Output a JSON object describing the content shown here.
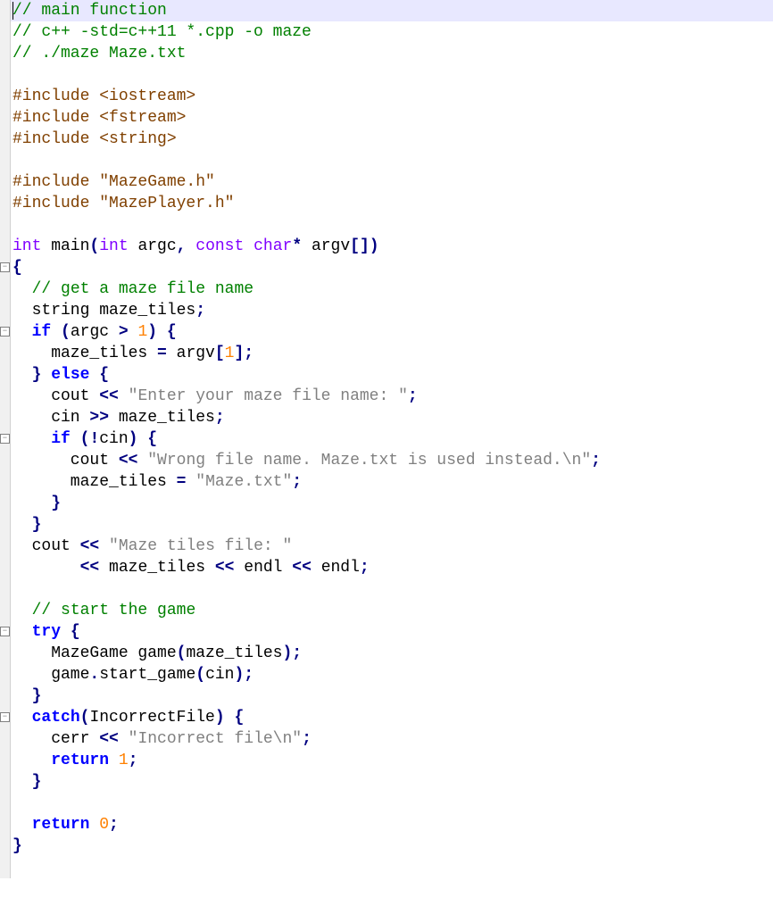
{
  "fold_markers": [
    {
      "line": 12,
      "symbol": "⊟"
    },
    {
      "line": 15,
      "symbol": "⊟"
    },
    {
      "line": 20,
      "symbol": "⊟"
    },
    {
      "line": 29,
      "symbol": "⊟"
    },
    {
      "line": 33,
      "symbol": "⊟"
    }
  ],
  "code_lines": [
    {
      "i": 0,
      "hl": true,
      "tokens": [
        {
          "t": "comment",
          "v": "// main function"
        }
      ],
      "cursor": true
    },
    {
      "i": 1,
      "tokens": [
        {
          "t": "comment",
          "v": "// c++ -std=c++11 *.cpp -o maze"
        }
      ]
    },
    {
      "i": 2,
      "tokens": [
        {
          "t": "comment",
          "v": "// ./maze Maze.txt"
        }
      ]
    },
    {
      "i": 3,
      "tokens": []
    },
    {
      "i": 4,
      "tokens": [
        {
          "t": "preproc",
          "v": "#include <iostream>"
        }
      ]
    },
    {
      "i": 5,
      "tokens": [
        {
          "t": "preproc",
          "v": "#include <fstream>"
        }
      ]
    },
    {
      "i": 6,
      "tokens": [
        {
          "t": "preproc",
          "v": "#include <string>"
        }
      ]
    },
    {
      "i": 7,
      "tokens": []
    },
    {
      "i": 8,
      "tokens": [
        {
          "t": "preproc",
          "v": "#include \"MazeGame.h\""
        }
      ]
    },
    {
      "i": 9,
      "tokens": [
        {
          "t": "preproc",
          "v": "#include \"MazePlayer.h\""
        }
      ]
    },
    {
      "i": 10,
      "tokens": []
    },
    {
      "i": 11,
      "tokens": [
        {
          "t": "type",
          "v": "int"
        },
        {
          "t": "ident",
          "v": " main"
        },
        {
          "t": "op",
          "v": "("
        },
        {
          "t": "type",
          "v": "int"
        },
        {
          "t": "ident",
          "v": " argc"
        },
        {
          "t": "op",
          "v": ","
        },
        {
          "t": "ident",
          "v": " "
        },
        {
          "t": "type",
          "v": "const"
        },
        {
          "t": "ident",
          "v": " "
        },
        {
          "t": "type",
          "v": "char"
        },
        {
          "t": "op",
          "v": "*"
        },
        {
          "t": "ident",
          "v": " argv"
        },
        {
          "t": "op",
          "v": "[])"
        }
      ]
    },
    {
      "i": 12,
      "tokens": [
        {
          "t": "op",
          "v": "{"
        }
      ]
    },
    {
      "i": 13,
      "tokens": [
        {
          "t": "ident",
          "v": "  "
        },
        {
          "t": "comment",
          "v": "// get a maze file name"
        }
      ]
    },
    {
      "i": 14,
      "tokens": [
        {
          "t": "ident",
          "v": "  string maze_tiles"
        },
        {
          "t": "op",
          "v": ";"
        }
      ]
    },
    {
      "i": 15,
      "tokens": [
        {
          "t": "ident",
          "v": "  "
        },
        {
          "t": "keyword",
          "v": "if"
        },
        {
          "t": "ident",
          "v": " "
        },
        {
          "t": "op",
          "v": "("
        },
        {
          "t": "ident",
          "v": "argc "
        },
        {
          "t": "op",
          "v": ">"
        },
        {
          "t": "ident",
          "v": " "
        },
        {
          "t": "number",
          "v": "1"
        },
        {
          "t": "op",
          "v": ")"
        },
        {
          "t": "ident",
          "v": " "
        },
        {
          "t": "op",
          "v": "{"
        }
      ]
    },
    {
      "i": 16,
      "tokens": [
        {
          "t": "ident",
          "v": "    maze_tiles "
        },
        {
          "t": "op",
          "v": "="
        },
        {
          "t": "ident",
          "v": " argv"
        },
        {
          "t": "op",
          "v": "["
        },
        {
          "t": "number",
          "v": "1"
        },
        {
          "t": "op",
          "v": "];"
        }
      ]
    },
    {
      "i": 17,
      "tokens": [
        {
          "t": "ident",
          "v": "  "
        },
        {
          "t": "op",
          "v": "}"
        },
        {
          "t": "ident",
          "v": " "
        },
        {
          "t": "keyword",
          "v": "else"
        },
        {
          "t": "ident",
          "v": " "
        },
        {
          "t": "op",
          "v": "{"
        }
      ]
    },
    {
      "i": 18,
      "tokens": [
        {
          "t": "ident",
          "v": "    cout "
        },
        {
          "t": "op",
          "v": "<<"
        },
        {
          "t": "ident",
          "v": " "
        },
        {
          "t": "string",
          "v": "\"Enter your maze file name: \""
        },
        {
          "t": "op",
          "v": ";"
        }
      ]
    },
    {
      "i": 19,
      "tokens": [
        {
          "t": "ident",
          "v": "    cin "
        },
        {
          "t": "op",
          "v": ">>"
        },
        {
          "t": "ident",
          "v": " maze_tiles"
        },
        {
          "t": "op",
          "v": ";"
        }
      ]
    },
    {
      "i": 20,
      "tokens": [
        {
          "t": "ident",
          "v": "    "
        },
        {
          "t": "keyword",
          "v": "if"
        },
        {
          "t": "ident",
          "v": " "
        },
        {
          "t": "op",
          "v": "(!"
        },
        {
          "t": "ident",
          "v": "cin"
        },
        {
          "t": "op",
          "v": ")"
        },
        {
          "t": "ident",
          "v": " "
        },
        {
          "t": "op",
          "v": "{"
        }
      ]
    },
    {
      "i": 21,
      "tokens": [
        {
          "t": "ident",
          "v": "      cout "
        },
        {
          "t": "op",
          "v": "<<"
        },
        {
          "t": "ident",
          "v": " "
        },
        {
          "t": "string",
          "v": "\"Wrong file name. Maze.txt is used instead.\\n\""
        },
        {
          "t": "op",
          "v": ";"
        }
      ]
    },
    {
      "i": 22,
      "tokens": [
        {
          "t": "ident",
          "v": "      maze_tiles "
        },
        {
          "t": "op",
          "v": "="
        },
        {
          "t": "ident",
          "v": " "
        },
        {
          "t": "string",
          "v": "\"Maze.txt\""
        },
        {
          "t": "op",
          "v": ";"
        }
      ]
    },
    {
      "i": 23,
      "tokens": [
        {
          "t": "ident",
          "v": "    "
        },
        {
          "t": "op",
          "v": "}"
        }
      ]
    },
    {
      "i": 24,
      "tokens": [
        {
          "t": "ident",
          "v": "  "
        },
        {
          "t": "op",
          "v": "}"
        }
      ]
    },
    {
      "i": 25,
      "tokens": [
        {
          "t": "ident",
          "v": "  cout "
        },
        {
          "t": "op",
          "v": "<<"
        },
        {
          "t": "ident",
          "v": " "
        },
        {
          "t": "string",
          "v": "\"Maze tiles file: \""
        }
      ]
    },
    {
      "i": 26,
      "tokens": [
        {
          "t": "ident",
          "v": "       "
        },
        {
          "t": "op",
          "v": "<<"
        },
        {
          "t": "ident",
          "v": " maze_tiles "
        },
        {
          "t": "op",
          "v": "<<"
        },
        {
          "t": "ident",
          "v": " endl "
        },
        {
          "t": "op",
          "v": "<<"
        },
        {
          "t": "ident",
          "v": " endl"
        },
        {
          "t": "op",
          "v": ";"
        }
      ]
    },
    {
      "i": 27,
      "tokens": []
    },
    {
      "i": 28,
      "tokens": [
        {
          "t": "ident",
          "v": "  "
        },
        {
          "t": "comment",
          "v": "// start the game"
        }
      ]
    },
    {
      "i": 29,
      "tokens": [
        {
          "t": "ident",
          "v": "  "
        },
        {
          "t": "keyword",
          "v": "try"
        },
        {
          "t": "ident",
          "v": " "
        },
        {
          "t": "op",
          "v": "{"
        }
      ]
    },
    {
      "i": 30,
      "tokens": [
        {
          "t": "ident",
          "v": "    MazeGame game"
        },
        {
          "t": "op",
          "v": "("
        },
        {
          "t": "ident",
          "v": "maze_tiles"
        },
        {
          "t": "op",
          "v": ");"
        }
      ]
    },
    {
      "i": 31,
      "tokens": [
        {
          "t": "ident",
          "v": "    game"
        },
        {
          "t": "op",
          "v": "."
        },
        {
          "t": "ident",
          "v": "start_game"
        },
        {
          "t": "op",
          "v": "("
        },
        {
          "t": "ident",
          "v": "cin"
        },
        {
          "t": "op",
          "v": ");"
        }
      ]
    },
    {
      "i": 32,
      "tokens": [
        {
          "t": "ident",
          "v": "  "
        },
        {
          "t": "op",
          "v": "}"
        }
      ]
    },
    {
      "i": 33,
      "tokens": [
        {
          "t": "ident",
          "v": "  "
        },
        {
          "t": "keyword",
          "v": "catch"
        },
        {
          "t": "op",
          "v": "("
        },
        {
          "t": "ident",
          "v": "IncorrectFile"
        },
        {
          "t": "op",
          "v": ")"
        },
        {
          "t": "ident",
          "v": " "
        },
        {
          "t": "op",
          "v": "{"
        }
      ]
    },
    {
      "i": 34,
      "tokens": [
        {
          "t": "ident",
          "v": "    cerr "
        },
        {
          "t": "op",
          "v": "<<"
        },
        {
          "t": "ident",
          "v": " "
        },
        {
          "t": "string",
          "v": "\"Incorrect file\\n\""
        },
        {
          "t": "op",
          "v": ";"
        }
      ]
    },
    {
      "i": 35,
      "tokens": [
        {
          "t": "ident",
          "v": "    "
        },
        {
          "t": "keyword",
          "v": "return"
        },
        {
          "t": "ident",
          "v": " "
        },
        {
          "t": "number",
          "v": "1"
        },
        {
          "t": "op",
          "v": ";"
        }
      ]
    },
    {
      "i": 36,
      "tokens": [
        {
          "t": "ident",
          "v": "  "
        },
        {
          "t": "op",
          "v": "}"
        }
      ]
    },
    {
      "i": 37,
      "tokens": []
    },
    {
      "i": 38,
      "tokens": [
        {
          "t": "ident",
          "v": "  "
        },
        {
          "t": "keyword",
          "v": "return"
        },
        {
          "t": "ident",
          "v": " "
        },
        {
          "t": "number",
          "v": "0"
        },
        {
          "t": "op",
          "v": ";"
        }
      ]
    },
    {
      "i": 39,
      "tokens": [
        {
          "t": "op",
          "v": "}"
        }
      ]
    },
    {
      "i": 40,
      "tokens": []
    }
  ]
}
